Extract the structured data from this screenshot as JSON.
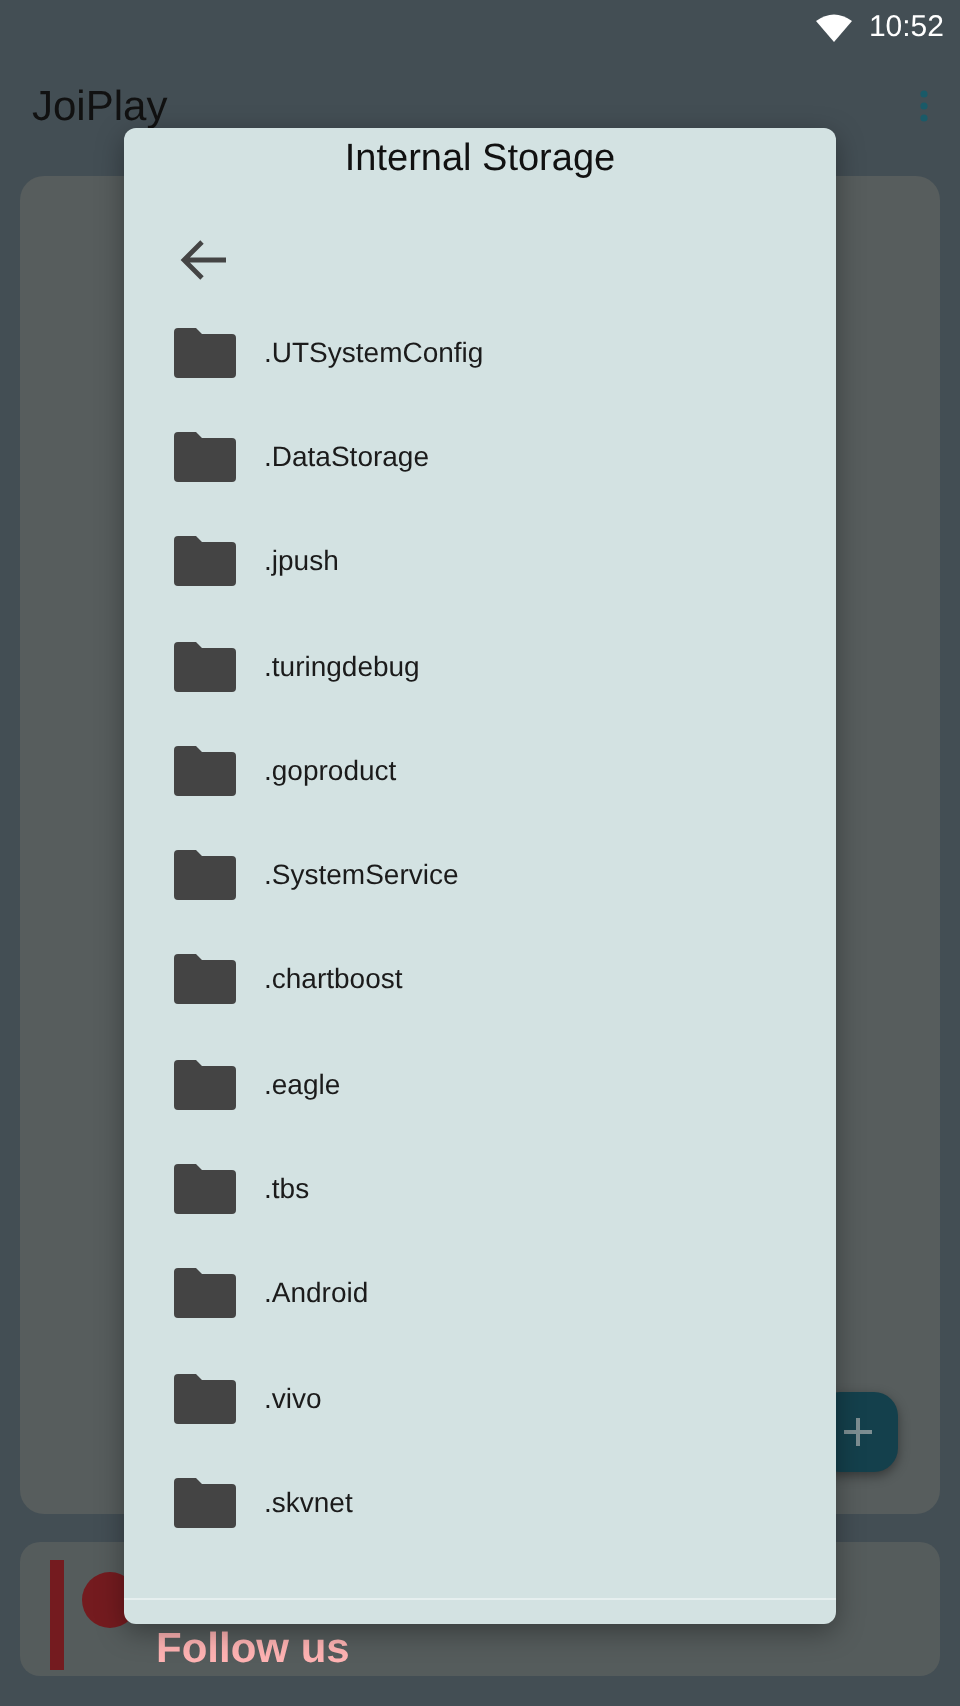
{
  "status_bar": {
    "time": "10:52"
  },
  "app_bar": {
    "title": "JoiPlay"
  },
  "banner": {
    "text": "Follow us"
  },
  "dialog": {
    "title": "Internal Storage",
    "folders": [
      {
        "name": ".UTSystemConfig"
      },
      {
        "name": ".DataStorage"
      },
      {
        "name": ".jpush"
      },
      {
        "name": ".turingdebug"
      },
      {
        "name": ".goproduct"
      },
      {
        "name": ".SystemService"
      },
      {
        "name": ".chartboost"
      },
      {
        "name": ".eagle"
      },
      {
        "name": ".tbs"
      },
      {
        "name": ".Android"
      },
      {
        "name": ".vivo"
      },
      {
        "name": ".skvnet"
      }
    ]
  }
}
